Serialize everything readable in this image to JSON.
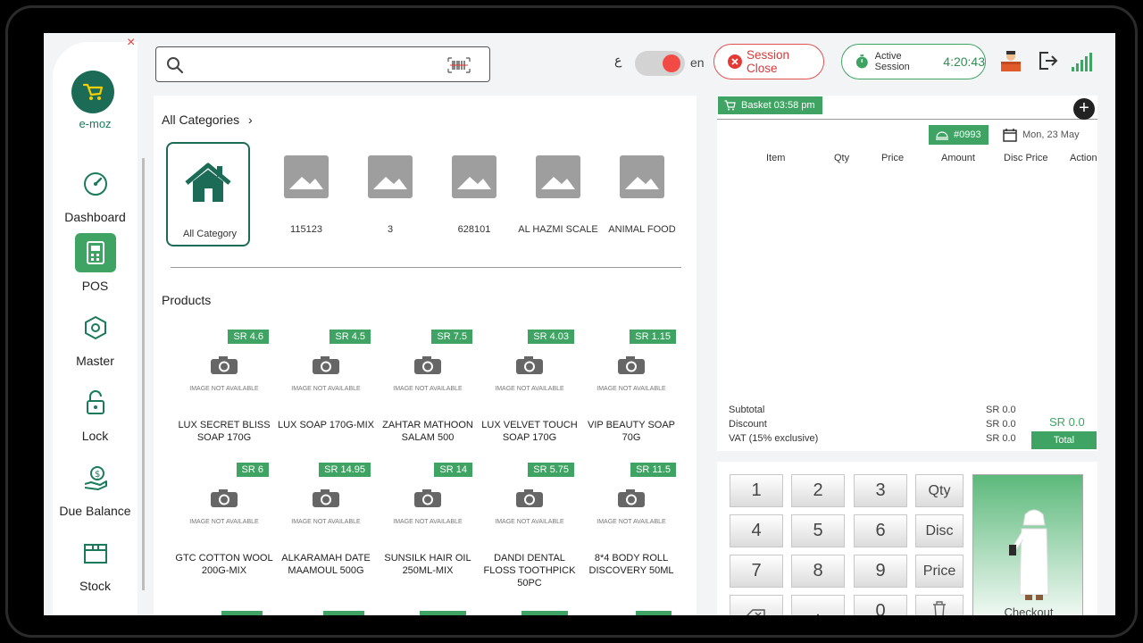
{
  "app": {
    "logo_text": "e-moz",
    "close_symbol": "×"
  },
  "sidebar": {
    "items": [
      {
        "label": "Dashboard",
        "icon": "dashboard-gauge-icon",
        "active": false
      },
      {
        "label": "POS",
        "icon": "pos-terminal-icon",
        "active": true
      },
      {
        "label": "Master",
        "icon": "box-gear-icon",
        "active": false
      },
      {
        "label": "Lock",
        "icon": "lock-icon",
        "active": false
      },
      {
        "label": "Due Balance",
        "icon": "money-hand-icon",
        "active": false
      },
      {
        "label": "Stock",
        "icon": "box-icon",
        "active": false
      }
    ]
  },
  "topbar": {
    "search_value": "",
    "lang_ar": "ع",
    "lang_en": "en",
    "session_close_label": "Session Close",
    "active_session_label": "Active Session",
    "session_timer": "4:20:43"
  },
  "categories": {
    "title": "All Categories",
    "items": [
      {
        "label": "All Category",
        "active": true
      },
      {
        "label": "115123"
      },
      {
        "label": "3"
      },
      {
        "label": "628101"
      },
      {
        "label": "AL HAZMI SCALE"
      },
      {
        "label": "ANIMAL FOOD"
      }
    ]
  },
  "products": {
    "title": "Products",
    "image_na_text": "IMAGE NOT AVAILABLE",
    "items": [
      {
        "price": "SR 4.6",
        "name": "LUX SECRET BLISS SOAP 170G"
      },
      {
        "price": "SR 4.5",
        "name": "LUX SOAP 170G-MIX"
      },
      {
        "price": "SR 7.5",
        "name": "ZAHTAR MATHOON SALAM 500"
      },
      {
        "price": "SR 4.03",
        "name": "LUX VELVET TOUCH SOAP 170G"
      },
      {
        "price": "SR 1.15",
        "name": "VIP BEAUTY SOAP 70G"
      },
      {
        "price": "SR 6",
        "name": "GTC  COTTON WOOL 200G-MIX"
      },
      {
        "price": "SR 14.95",
        "name": "ALKARAMAH DATE MAAMOUL 500G"
      },
      {
        "price": "SR 14",
        "name": "SUNSILK HAIR OIL 250ML-MIX"
      },
      {
        "price": "SR 5.75",
        "name": "DANDI DENTAL FLOSS TOOTHPICK 50PC"
      },
      {
        "price": "SR 11.5",
        "name": "8*4 BODY ROLL DISCOVERY 50ML"
      }
    ]
  },
  "basket": {
    "tag": "Basket 03:58 pm",
    "order_no": "#0993",
    "date": "Mon, 23 May",
    "columns": [
      "Item",
      "Qty",
      "Price",
      "Amount",
      "Disc Price",
      "Action"
    ],
    "summary": [
      {
        "label": "Subtotal",
        "value": "SR 0.0"
      },
      {
        "label": "Discount",
        "value": "SR 0.0"
      },
      {
        "label": "VAT (15% exclusive)",
        "value": "SR 0.0"
      }
    ],
    "total_value": "SR 0.0",
    "total_label": "Total"
  },
  "keypad": {
    "keys": [
      "1",
      "2",
      "3",
      "Qty",
      "4",
      "5",
      "6",
      "Disc",
      "7",
      "8",
      "9",
      "Price",
      "",
      "",
      "0",
      ""
    ],
    "checkout_label": "Checkout"
  },
  "colors": {
    "brand_green": "#3fa463",
    "dark_green": "#1c6b57",
    "danger": "#e53935"
  }
}
